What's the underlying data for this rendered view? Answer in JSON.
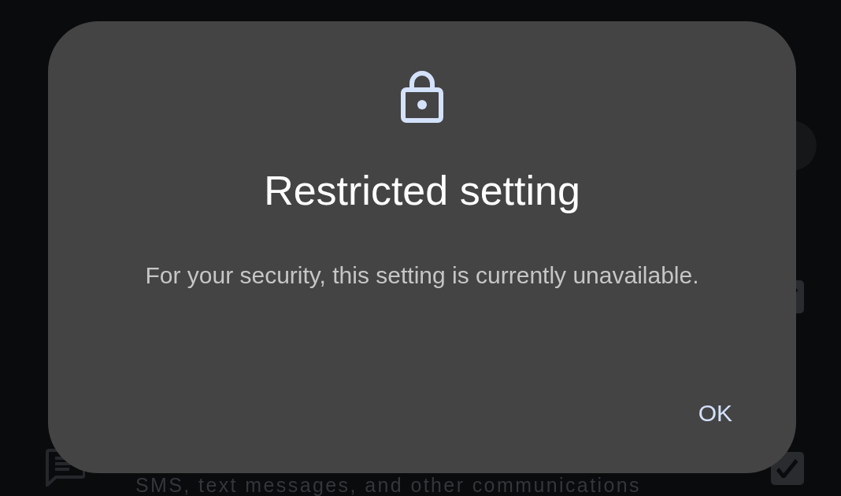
{
  "settings_list": {
    "items": [
      {
        "kind": "circle"
      },
      {
        "kind": "checkbox",
        "checked": true
      },
      {
        "kind": "checkbox",
        "checked": true,
        "subtitle": "SMS, text messages, and other communications"
      }
    ]
  },
  "dialog": {
    "title": "Restricted setting",
    "message": "For your security, this setting is currently unavailable.",
    "buttons": [
      "OK"
    ]
  }
}
